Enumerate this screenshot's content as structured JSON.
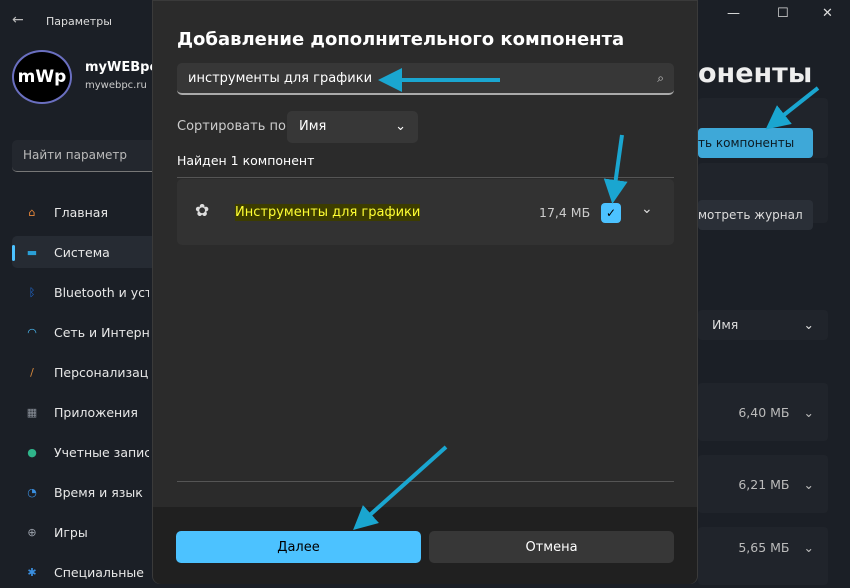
{
  "window": {
    "title": "Параметры",
    "back": "←",
    "minimize": "—",
    "maximize": "☐",
    "close": "✕"
  },
  "user": {
    "avatar_text": "mWp",
    "name": "myWEBpc",
    "email": "mywebpc.ru"
  },
  "sidebar": {
    "search_placeholder": "Найти параметр",
    "items": [
      {
        "label": "Главная",
        "icon": "home-icon",
        "color": "#e8873a"
      },
      {
        "label": "Система",
        "icon": "system-icon",
        "color": "#2a9fd6"
      },
      {
        "label": "Bluetooth и устройства",
        "icon": "bluetooth-icon",
        "color": "#1f6fe0"
      },
      {
        "label": "Сеть и Интернет",
        "icon": "wifi-icon",
        "color": "#4cc2ff"
      },
      {
        "label": "Персонализация",
        "icon": "brush-icon",
        "color": "#d88a3c"
      },
      {
        "label": "Приложения",
        "icon": "apps-icon",
        "color": "#8a9099"
      },
      {
        "label": "Учетные записи",
        "icon": "account-icon",
        "color": "#2fb58a"
      },
      {
        "label": "Время и язык",
        "icon": "time-language-icon",
        "color": "#3a8fe0"
      },
      {
        "label": "Игры",
        "icon": "gamepad-icon",
        "color": "#9aa0aa"
      },
      {
        "label": "Специальные возможности",
        "icon": "accessibility-icon",
        "color": "#3a8fe0"
      }
    ]
  },
  "background_page": {
    "title_fragment": "оненты",
    "view_features_button": "ть компоненты",
    "view_history_button": "мотреть журнал",
    "sort_value": "Имя",
    "sizes": [
      "6,40 МБ",
      "6,21 МБ",
      "5,65 МБ"
    ]
  },
  "dialog": {
    "title": "Добавление дополнительного компонента",
    "search_value": "инструменты для графики",
    "sort_label": "Сортировать по:",
    "sort_value": "Имя",
    "found_text": "Найден 1 компонент",
    "items": [
      {
        "name": "Инструменты для графики",
        "size": "17,4 МБ",
        "checked": true
      }
    ],
    "next_button": "Далее",
    "cancel_button": "Отмена"
  },
  "colors": {
    "accent": "#4cc2ff",
    "annotation_arrow": "#1aa6d0",
    "highlight": "#ffff33"
  }
}
